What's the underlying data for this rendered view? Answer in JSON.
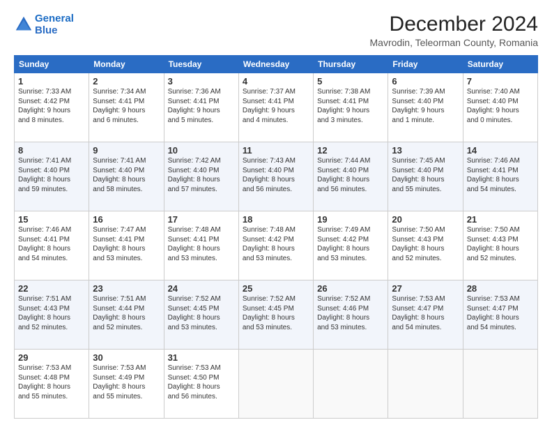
{
  "header": {
    "logo_line1": "General",
    "logo_line2": "Blue",
    "main_title": "December 2024",
    "subtitle": "Mavrodin, Teleorman County, Romania"
  },
  "weekdays": [
    "Sunday",
    "Monday",
    "Tuesday",
    "Wednesday",
    "Thursday",
    "Friday",
    "Saturday"
  ],
  "weeks": [
    [
      {
        "day": "1",
        "info": "Sunrise: 7:33 AM\nSunset: 4:42 PM\nDaylight: 9 hours\nand 8 minutes."
      },
      {
        "day": "2",
        "info": "Sunrise: 7:34 AM\nSunset: 4:41 PM\nDaylight: 9 hours\nand 6 minutes."
      },
      {
        "day": "3",
        "info": "Sunrise: 7:36 AM\nSunset: 4:41 PM\nDaylight: 9 hours\nand 5 minutes."
      },
      {
        "day": "4",
        "info": "Sunrise: 7:37 AM\nSunset: 4:41 PM\nDaylight: 9 hours\nand 4 minutes."
      },
      {
        "day": "5",
        "info": "Sunrise: 7:38 AM\nSunset: 4:41 PM\nDaylight: 9 hours\nand 3 minutes."
      },
      {
        "day": "6",
        "info": "Sunrise: 7:39 AM\nSunset: 4:40 PM\nDaylight: 9 hours\nand 1 minute."
      },
      {
        "day": "7",
        "info": "Sunrise: 7:40 AM\nSunset: 4:40 PM\nDaylight: 9 hours\nand 0 minutes."
      }
    ],
    [
      {
        "day": "8",
        "info": "Sunrise: 7:41 AM\nSunset: 4:40 PM\nDaylight: 8 hours\nand 59 minutes."
      },
      {
        "day": "9",
        "info": "Sunrise: 7:41 AM\nSunset: 4:40 PM\nDaylight: 8 hours\nand 58 minutes."
      },
      {
        "day": "10",
        "info": "Sunrise: 7:42 AM\nSunset: 4:40 PM\nDaylight: 8 hours\nand 57 minutes."
      },
      {
        "day": "11",
        "info": "Sunrise: 7:43 AM\nSunset: 4:40 PM\nDaylight: 8 hours\nand 56 minutes."
      },
      {
        "day": "12",
        "info": "Sunrise: 7:44 AM\nSunset: 4:40 PM\nDaylight: 8 hours\nand 56 minutes."
      },
      {
        "day": "13",
        "info": "Sunrise: 7:45 AM\nSunset: 4:40 PM\nDaylight: 8 hours\nand 55 minutes."
      },
      {
        "day": "14",
        "info": "Sunrise: 7:46 AM\nSunset: 4:41 PM\nDaylight: 8 hours\nand 54 minutes."
      }
    ],
    [
      {
        "day": "15",
        "info": "Sunrise: 7:46 AM\nSunset: 4:41 PM\nDaylight: 8 hours\nand 54 minutes."
      },
      {
        "day": "16",
        "info": "Sunrise: 7:47 AM\nSunset: 4:41 PM\nDaylight: 8 hours\nand 53 minutes."
      },
      {
        "day": "17",
        "info": "Sunrise: 7:48 AM\nSunset: 4:41 PM\nDaylight: 8 hours\nand 53 minutes."
      },
      {
        "day": "18",
        "info": "Sunrise: 7:48 AM\nSunset: 4:42 PM\nDaylight: 8 hours\nand 53 minutes."
      },
      {
        "day": "19",
        "info": "Sunrise: 7:49 AM\nSunset: 4:42 PM\nDaylight: 8 hours\nand 53 minutes."
      },
      {
        "day": "20",
        "info": "Sunrise: 7:50 AM\nSunset: 4:43 PM\nDaylight: 8 hours\nand 52 minutes."
      },
      {
        "day": "21",
        "info": "Sunrise: 7:50 AM\nSunset: 4:43 PM\nDaylight: 8 hours\nand 52 minutes."
      }
    ],
    [
      {
        "day": "22",
        "info": "Sunrise: 7:51 AM\nSunset: 4:43 PM\nDaylight: 8 hours\nand 52 minutes."
      },
      {
        "day": "23",
        "info": "Sunrise: 7:51 AM\nSunset: 4:44 PM\nDaylight: 8 hours\nand 52 minutes."
      },
      {
        "day": "24",
        "info": "Sunrise: 7:52 AM\nSunset: 4:45 PM\nDaylight: 8 hours\nand 53 minutes."
      },
      {
        "day": "25",
        "info": "Sunrise: 7:52 AM\nSunset: 4:45 PM\nDaylight: 8 hours\nand 53 minutes."
      },
      {
        "day": "26",
        "info": "Sunrise: 7:52 AM\nSunset: 4:46 PM\nDaylight: 8 hours\nand 53 minutes."
      },
      {
        "day": "27",
        "info": "Sunrise: 7:53 AM\nSunset: 4:47 PM\nDaylight: 8 hours\nand 54 minutes."
      },
      {
        "day": "28",
        "info": "Sunrise: 7:53 AM\nSunset: 4:47 PM\nDaylight: 8 hours\nand 54 minutes."
      }
    ],
    [
      {
        "day": "29",
        "info": "Sunrise: 7:53 AM\nSunset: 4:48 PM\nDaylight: 8 hours\nand 55 minutes."
      },
      {
        "day": "30",
        "info": "Sunrise: 7:53 AM\nSunset: 4:49 PM\nDaylight: 8 hours\nand 55 minutes."
      },
      {
        "day": "31",
        "info": "Sunrise: 7:53 AM\nSunset: 4:50 PM\nDaylight: 8 hours\nand 56 minutes."
      },
      null,
      null,
      null,
      null
    ]
  ]
}
